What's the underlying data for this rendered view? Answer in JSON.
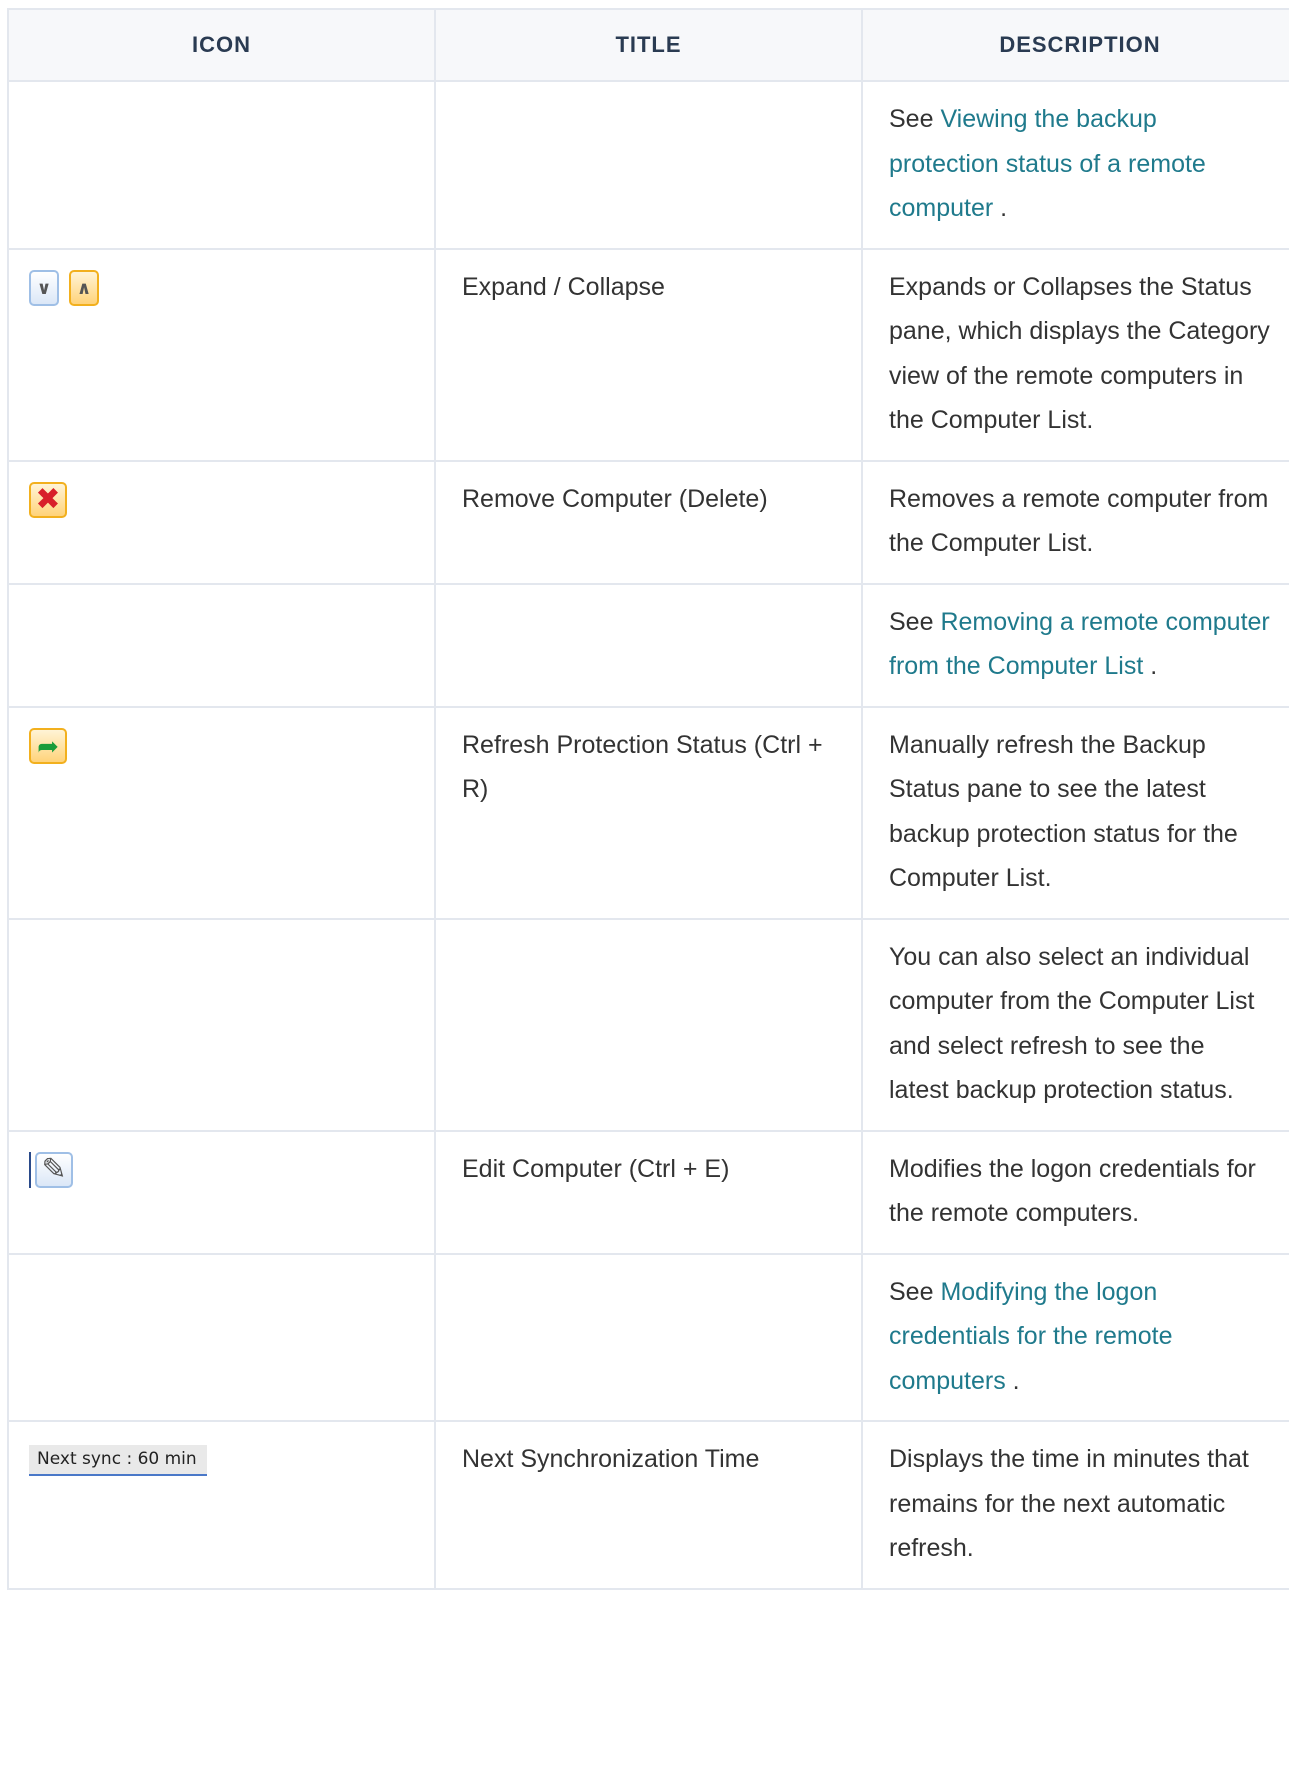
{
  "table": {
    "headers": {
      "icon": "ICON",
      "title": "TITLE",
      "description": "DESCRIPTION"
    },
    "rows": [
      {
        "icon": "",
        "title": "",
        "desc_prefix": "See ",
        "desc_link": "Viewing the backup protection status of a remote computer",
        "desc_suffix": " ."
      },
      {
        "icon": "expand-collapse-icons",
        "title": "Expand / Collapse",
        "description": "Expands or Collapses the Status pane, which displays the Category view of the remote computers in the Computer List."
      },
      {
        "icon": "remove-computer-icon",
        "title": "Remove Computer (Delete)",
        "description": "Removes a remote computer from the Computer List."
      },
      {
        "icon": "",
        "title": "",
        "desc_prefix": "See ",
        "desc_link": "Removing a remote computer from the Computer List",
        "desc_suffix": " ."
      },
      {
        "icon": "refresh-icon",
        "title": "Refresh Protection Status (Ctrl + R)",
        "description": "Manually refresh the Backup Status pane to see the latest backup protection status for the Computer List."
      },
      {
        "icon": "",
        "title": "",
        "description": "You can also select an individual computer from the Computer List and select refresh to see the latest backup protection status."
      },
      {
        "icon": "edit-computer-icon",
        "title": "Edit Computer (Ctrl + E)",
        "description": "Modifies the logon credentials for the remote computers."
      },
      {
        "icon": "",
        "title": "",
        "desc_prefix": "See ",
        "desc_link": "Modifying the logon credentials for the remote computers",
        "desc_suffix": " ."
      },
      {
        "icon_text": "Next sync : 60 min",
        "title": "Next Synchronization Time",
        "description": "Displays the time in minutes that remains for the next automatic refresh."
      }
    ]
  },
  "colors": {
    "link": "#1f7a8c",
    "header_text": "#2a3b52",
    "border": "#e3e7ee"
  }
}
